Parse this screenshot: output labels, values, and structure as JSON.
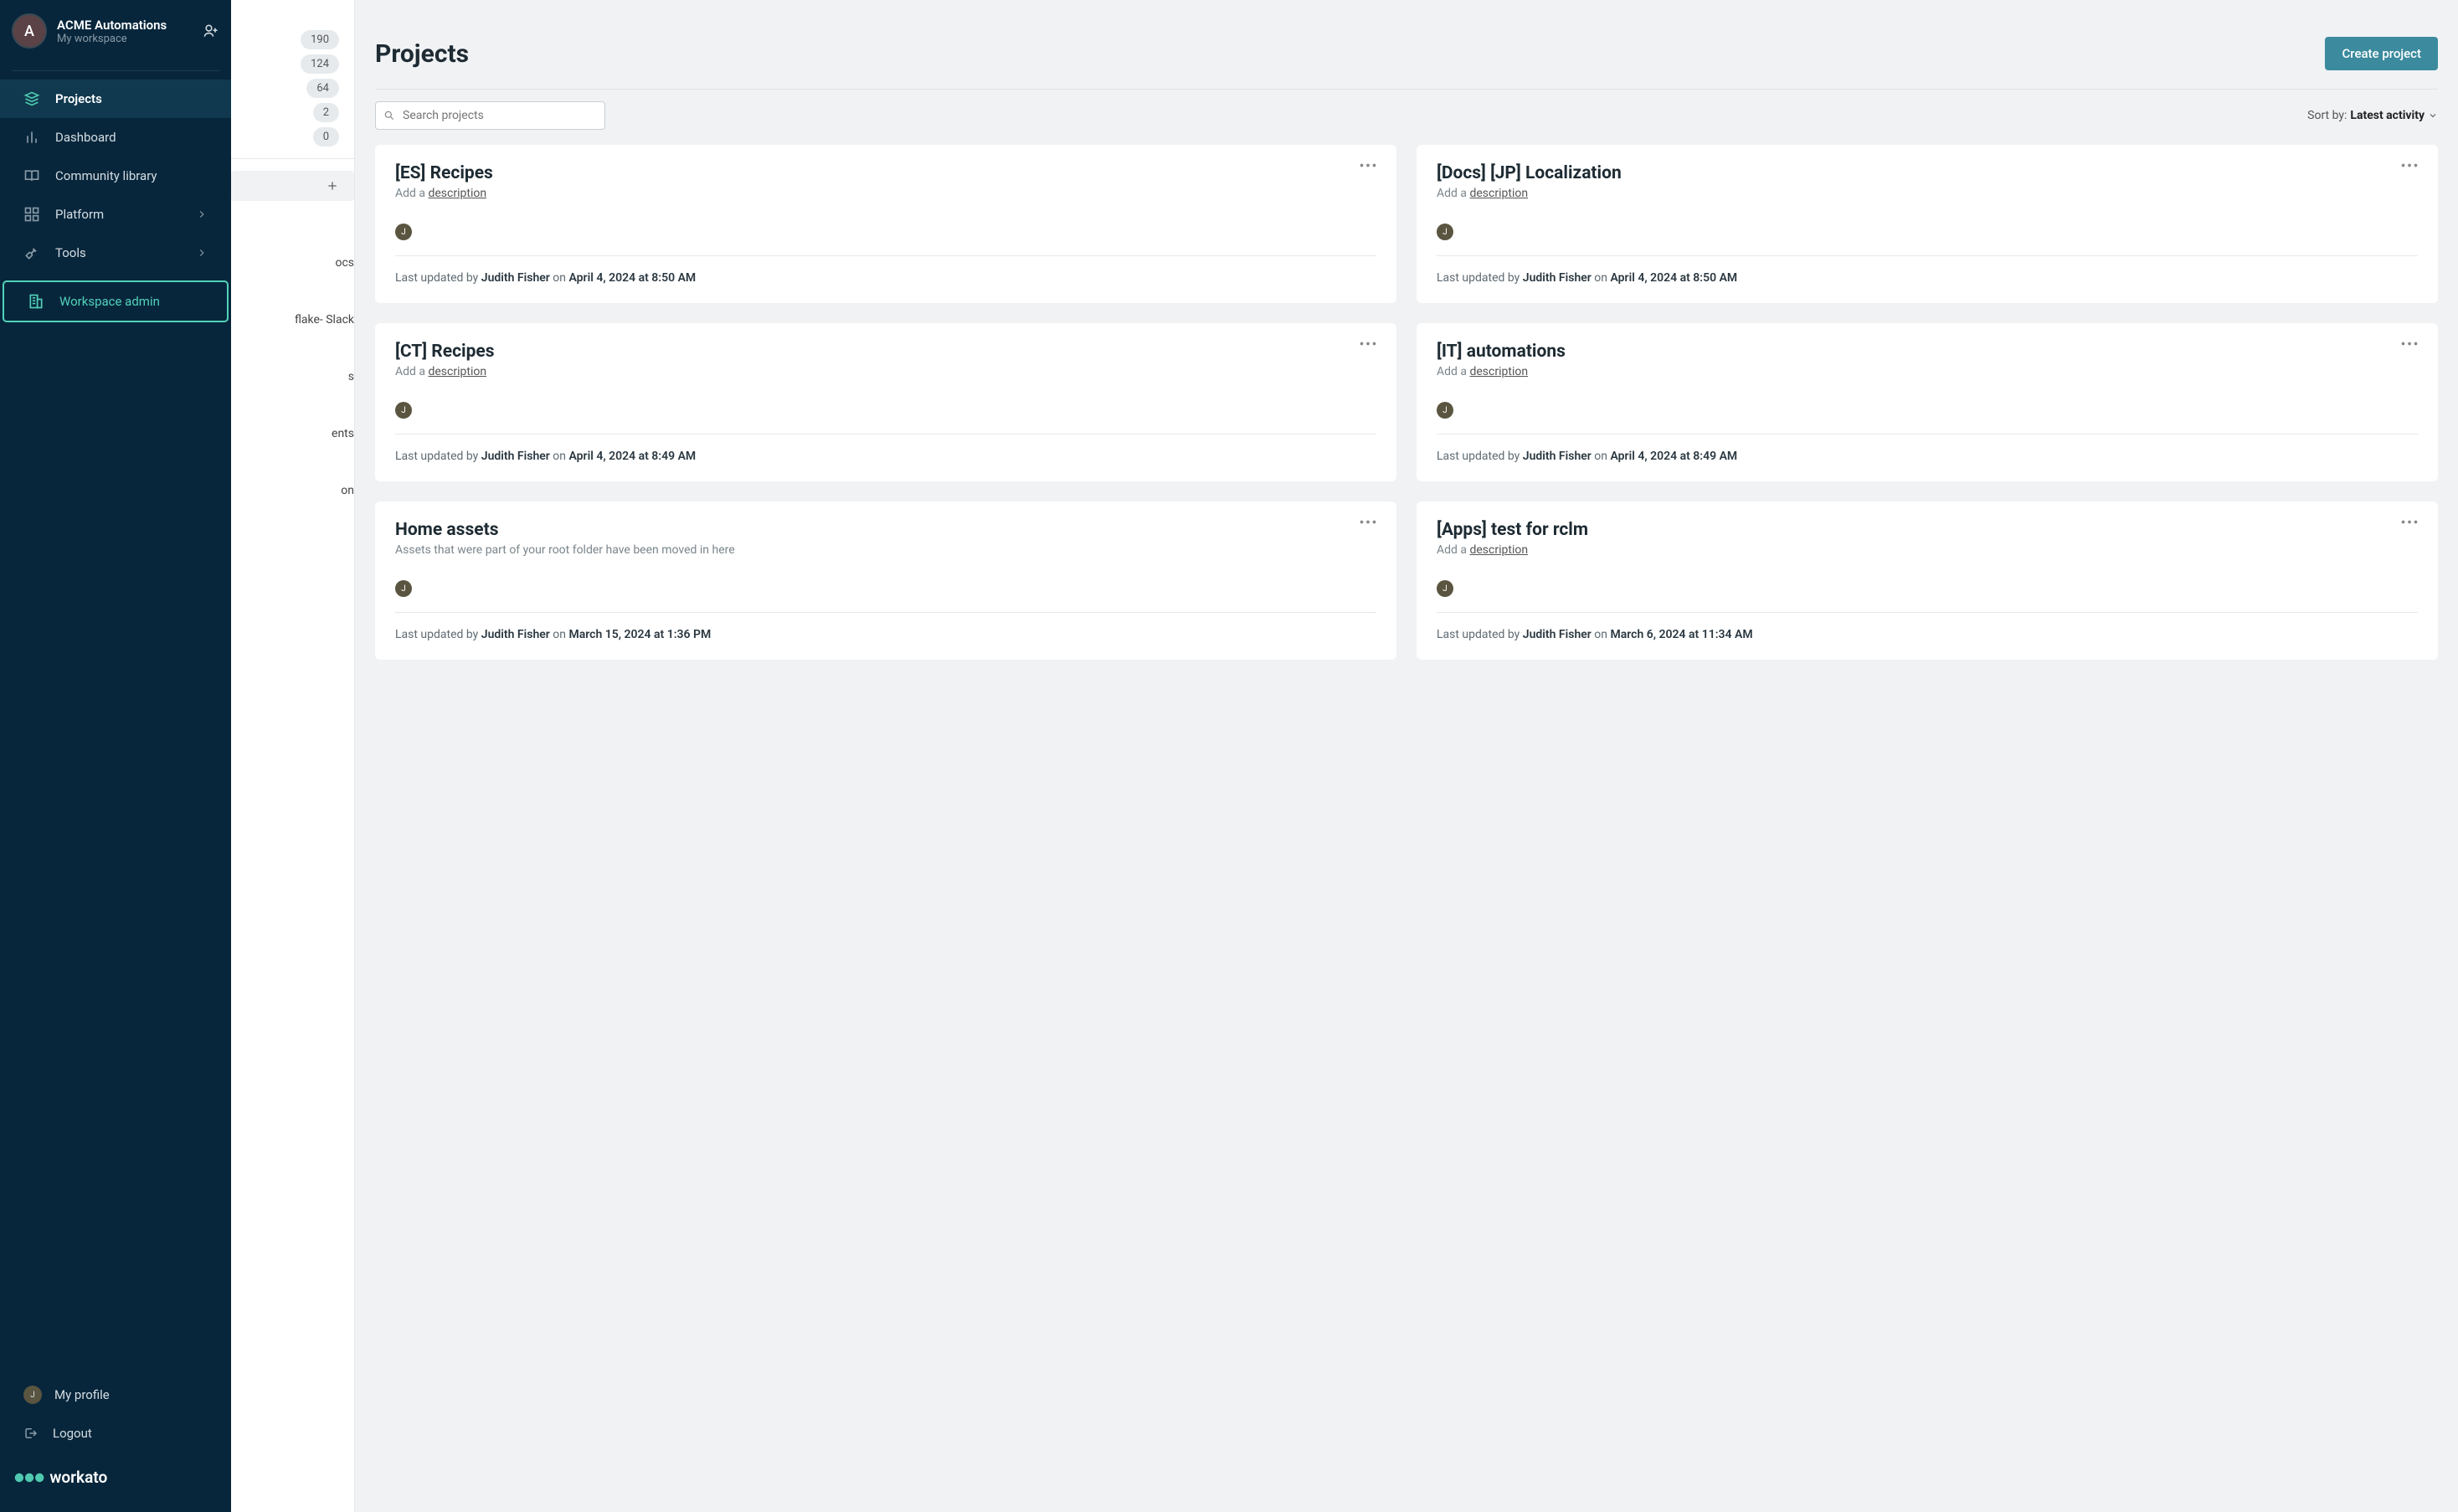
{
  "workspace": {
    "avatar_letter": "A",
    "name": "ACME Automations",
    "subtitle": "My workspace"
  },
  "nav": {
    "projects": "Projects",
    "dashboard": "Dashboard",
    "community": "Community library",
    "platform": "Platform",
    "tools": "Tools",
    "admin": "Workspace admin",
    "profile": "My profile",
    "logout": "Logout"
  },
  "profile_letter": "J",
  "counts": [
    "190",
    "124",
    "64",
    "2",
    "0"
  ],
  "peek_texts": [
    "ocs",
    "flake- Slack",
    "s",
    "ents",
    "on"
  ],
  "header": {
    "title": "Projects",
    "create_btn": "Create project"
  },
  "search": {
    "placeholder": "Search projects"
  },
  "sort": {
    "prefix": "Sort by:",
    "value": "Latest activity"
  },
  "desc_prefix": "Add a ",
  "desc_link": "description",
  "footer_prefix": "Last updated by ",
  "on_word": "on",
  "cards": [
    {
      "title": "[ES] Recipes",
      "desc": null,
      "avatar": "J",
      "user": "Judith Fisher",
      "date": "April 4, 2024 at 8:50 AM"
    },
    {
      "title": "[Docs] [JP] Localization",
      "desc": null,
      "avatar": "J",
      "user": "Judith Fisher",
      "date": "April 4, 2024 at 8:50 AM"
    },
    {
      "title": "[CT] Recipes",
      "desc": null,
      "avatar": "J",
      "user": "Judith Fisher",
      "date": "April 4, 2024 at 8:49 AM"
    },
    {
      "title": "[IT] automations",
      "desc": null,
      "avatar": "J",
      "user": "Judith Fisher",
      "date": "April 4, 2024 at 8:49 AM"
    },
    {
      "title": "Home assets",
      "desc": "Assets that were part of your root folder have been moved in here",
      "avatar": "J",
      "user": "Judith Fisher",
      "date": "March 15, 2024 at 1:36 PM"
    },
    {
      "title": "[Apps] test for rclm",
      "desc": null,
      "avatar": "J",
      "user": "Judith Fisher",
      "date": "March 6, 2024 at 11:34 AM"
    }
  ]
}
